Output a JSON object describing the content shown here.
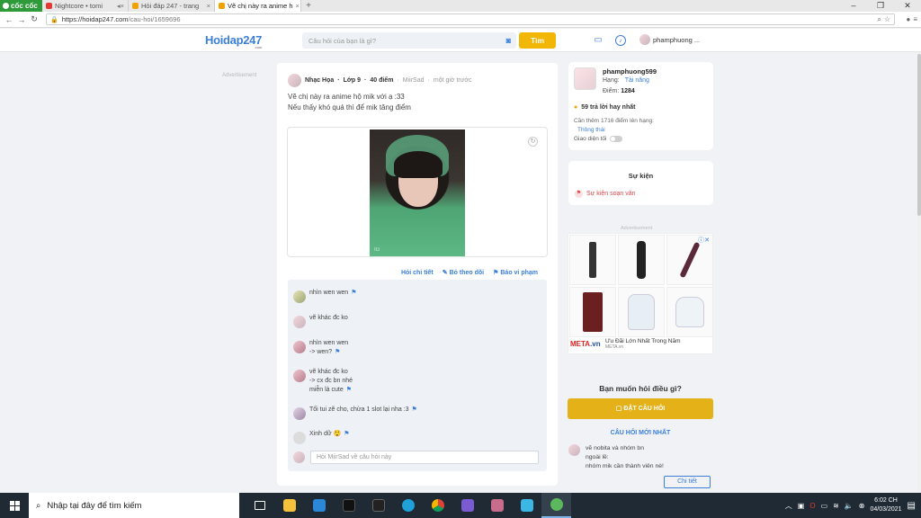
{
  "browser": {
    "brand": "cốc cốc",
    "tabs": [
      {
        "title": "Nightcore • tomi",
        "active": false,
        "color": "#e53935"
      },
      {
        "title": "Hỏi đáp 247 - trang",
        "active": false,
        "color": "#f2a200"
      },
      {
        "title": "Vẽ chị này ra anime h",
        "active": true,
        "color": "#f2a200"
      }
    ],
    "url_host": "https://hoidap247.com",
    "url_path": "/cau-hoi/1659696"
  },
  "header": {
    "logo_main": "Hoidap247",
    "logo_sub": ".com",
    "search_placeholder": "Câu hỏi của bạn là gì?",
    "search_button": "Tìm",
    "username": "phamphuong ..."
  },
  "ad_label": "Advertisement",
  "question": {
    "author": "Nhạc Họa",
    "grade": "Lớp 9",
    "points": "40 điểm",
    "asker": "MiirSad",
    "time": "một giờ trước",
    "line1": "Vẽ chị này ra anime hộ mik với ạ :33",
    "line2": "Nếu thấy khó quá thì để mik tăng điểm",
    "photo_watermark": "IG"
  },
  "actions": {
    "detail": "Hỏi chi tiết",
    "unfollow": "Bỏ theo dõi",
    "report": "Báo vi phạm"
  },
  "comments": [
    {
      "lines": [
        "nhìn wen wen"
      ]
    },
    {
      "lines": [
        "vẽ khác đc ko"
      ]
    },
    {
      "lines": [
        "nhìn wen wen",
        "-> wen?"
      ]
    },
    {
      "lines": [
        "vẽ khác đc ko",
        "-> cx đc bn nhé",
        "miễn là cute"
      ]
    },
    {
      "lines": [
        "Tối tui zẽ cho, chừa 1 slot lại nha :3"
      ]
    },
    {
      "lines": [
        "Xinh dữ 😲"
      ]
    }
  ],
  "reply_placeholder": "Hỏi MiirSad về câu hỏi này",
  "profile": {
    "name": "phamphuong599",
    "rank_label": "Hạng:",
    "rank_value": "Tài năng",
    "points_label": "Điểm:",
    "points_value": "1284",
    "best_answers": "59 trả lời hay nhất",
    "need_more": "Cần thêm 1716 điểm lên hạng:",
    "next_rank": "Thông thái",
    "dark_mode": "Giao diện tối"
  },
  "event": {
    "title": "Sự kiện",
    "item": "Sự kiện soạn văn"
  },
  "ad": {
    "label": "Advertisement",
    "brand_red": "META",
    "brand_blue": ".vn",
    "text": "Ưu Đãi Lớn Nhất Trong Năm",
    "sub": "META.vn"
  },
  "ask": {
    "title": "Bạn muốn hỏi điều gì?",
    "button": "ĐẶT CÂU HỎI"
  },
  "newest": {
    "title": "CÂU HỎI MỚI NHẤT",
    "lines": [
      "vẽ nobita và nhóm bn",
      "ngoài lề:",
      "nhóm mik cần thành viên nè!"
    ],
    "detail_button": "Chi tiết"
  },
  "taskbar": {
    "search_placeholder": "Nhập tại đây để tìm kiếm",
    "time": "6:02 CH",
    "date": "04/03/2021"
  },
  "colors": {
    "accent": "#3b7fd6",
    "yellow": "#f2b705",
    "ask_button": "#e5b119"
  }
}
